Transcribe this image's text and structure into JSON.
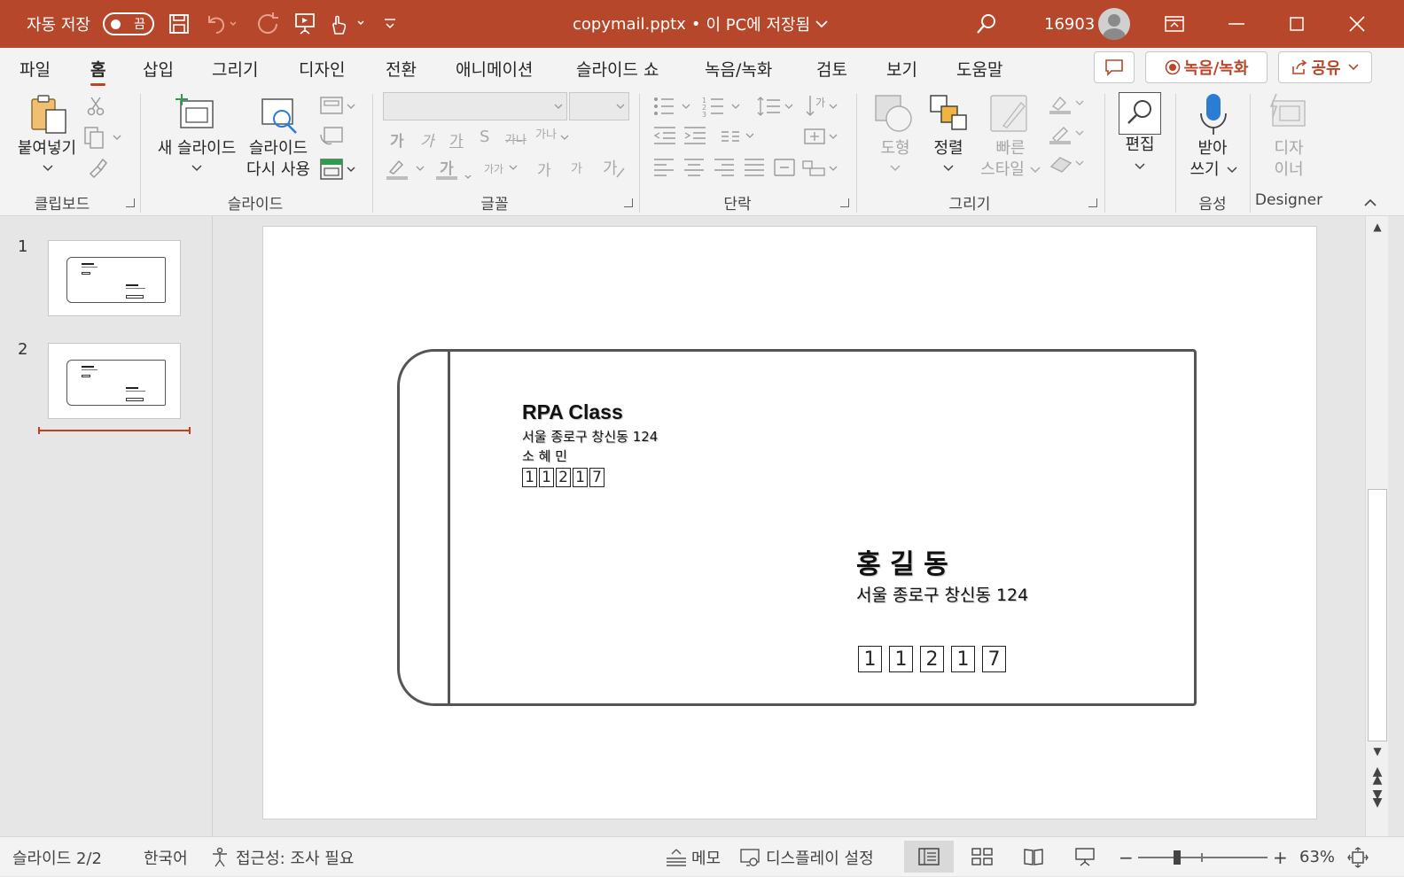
{
  "titlebar": {
    "autosave_label": "자동 저장",
    "autosave_state": "끔",
    "filename": "copymail.pptx",
    "separator": "•",
    "save_location": "이 PC에 저장됨",
    "user_id": "16903"
  },
  "menu": {
    "tabs": [
      "파일",
      "홈",
      "삽입",
      "그리기",
      "디자인",
      "전환",
      "애니메이션",
      "슬라이드 쇼",
      "녹음/녹화",
      "검토",
      "보기",
      "도움말"
    ],
    "active_index": 1,
    "record_button": "녹음/녹화",
    "share_button": "공유"
  },
  "ribbon": {
    "groups": {
      "clipboard": "클립보드",
      "slides": "슬라이드",
      "font": "글꼴",
      "paragraph": "단락",
      "drawing": "그리기",
      "voice": "음성",
      "designer": "Designer"
    },
    "paste": "붙여넣기",
    "new_slide": "새 슬라이드",
    "reuse_slide_1": "슬라이드",
    "reuse_slide_2": "다시 사용",
    "shapes": "도형",
    "arrange": "정렬",
    "quick_styles_1": "빠른",
    "quick_styles_2": "스타일",
    "editing": "편집",
    "dictate_1": "받아",
    "dictate_2": "쓰기",
    "designer_1": "디자",
    "designer_2": "이너",
    "font_buttons": [
      "가",
      "가",
      "가",
      "S",
      "가나",
      "가나"
    ],
    "font_size_buttons": [
      "가",
      "가"
    ]
  },
  "slides": [
    {
      "number": "1"
    },
    {
      "number": "2"
    }
  ],
  "slide": {
    "sender_name": "RPA Class",
    "sender_address": "서울 종로구 창신동 124",
    "sender_person": "소 혜 민",
    "sender_zip": [
      "1",
      "1",
      "2",
      "1",
      "7"
    ],
    "recipient_name": "홍 길 동",
    "recipient_address": "서울 종로구 창신동 124",
    "recipient_zip": [
      "1",
      "1",
      "2",
      "1",
      "7"
    ]
  },
  "statusbar": {
    "slide_info": "슬라이드 2/2",
    "language": "한국어",
    "accessibility": "접근성: 조사 필요",
    "notes": "메모",
    "display_settings": "디스플레이 설정",
    "zoom_minus": "−",
    "zoom_plus": "+",
    "zoom": "63%"
  },
  "colors": {
    "accent": "#b7472a",
    "ribbon_bg": "#f3f3f3",
    "workspace_bg": "#e6e6e6"
  }
}
